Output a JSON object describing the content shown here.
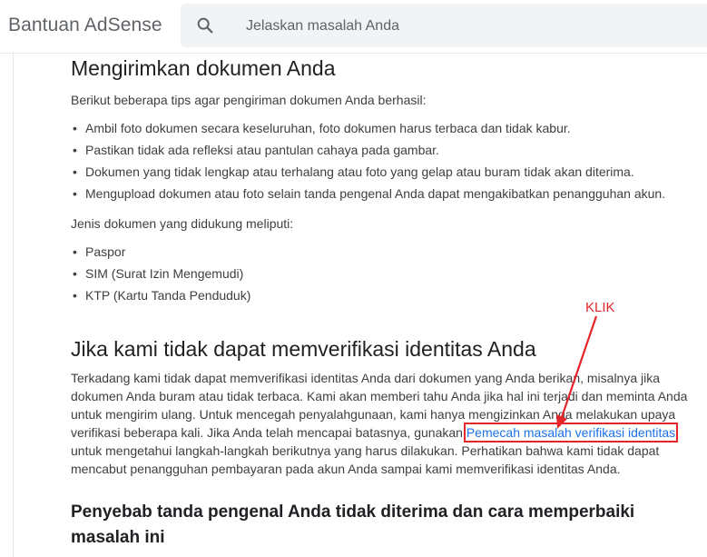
{
  "header": {
    "app_title": "Bantuan AdSense",
    "search_placeholder": "Jelaskan masalah Anda"
  },
  "sections": {
    "submit": {
      "heading": "Mengirimkan dokumen Anda",
      "intro": "Berikut beberapa tips agar pengiriman dokumen Anda berhasil:",
      "tips": [
        "Ambil foto dokumen secara keseluruhan, foto dokumen harus terbaca dan tidak kabur.",
        "Pastikan tidak ada refleksi atau pantulan cahaya pada gambar.",
        "Dokumen yang tidak lengkap atau terhalang atau foto yang gelap atau buram tidak akan diterima.",
        "Mengupload dokumen atau foto selain tanda pengenal Anda dapat mengakibatkan penangguhan akun."
      ],
      "doc_types_intro": "Jenis dokumen yang didukung meliputi:",
      "doc_types": [
        "Paspor",
        "SIM (Surat Izin Mengemudi)",
        "KTP (Kartu Tanda Penduduk)"
      ]
    },
    "cannot_verify": {
      "heading": "Jika kami tidak dapat memverifikasi identitas Anda",
      "lines": [
        "Terkadang kami tidak dapat memverifikasi identitas Anda dari dokumen yang Anda berikan, misalnya jika",
        "dokumen Anda buram atau tidak terbaca. Kami akan memberi tahu Anda jika hal ini terjadi dan meminta Anda",
        "untuk mengirim ulang. Untuk mencegah penyalahgunaan, kami hanya mengizinkan Anda melakukan upaya"
      ],
      "line4_before": "verifikasi beberapa kali. Jika Anda telah mencapai batasnya, gunakan ",
      "link_text": "Pemecah masalah verifikasi identitas",
      "line5": "untuk mengetahui langkah-langkah berikutnya yang harus dilakukan. Perhatikan bahwa kami tidak dapat",
      "line6": "mencabut penangguhan pembayaran pada akun Anda sampai kami memverifikasi identitas Anda."
    },
    "reasons": {
      "heading_line1": "Penyebab tanda pengenal Anda tidak diterima dan cara memperbaiki",
      "heading_line2": "masalah ini"
    }
  },
  "annotation": {
    "label": "KLIK",
    "color": "#e3262a"
  },
  "colors": {
    "link": "#1a73e8",
    "text": "#3c4043",
    "heading": "#202124"
  },
  "icons": {
    "search": "search-icon"
  }
}
